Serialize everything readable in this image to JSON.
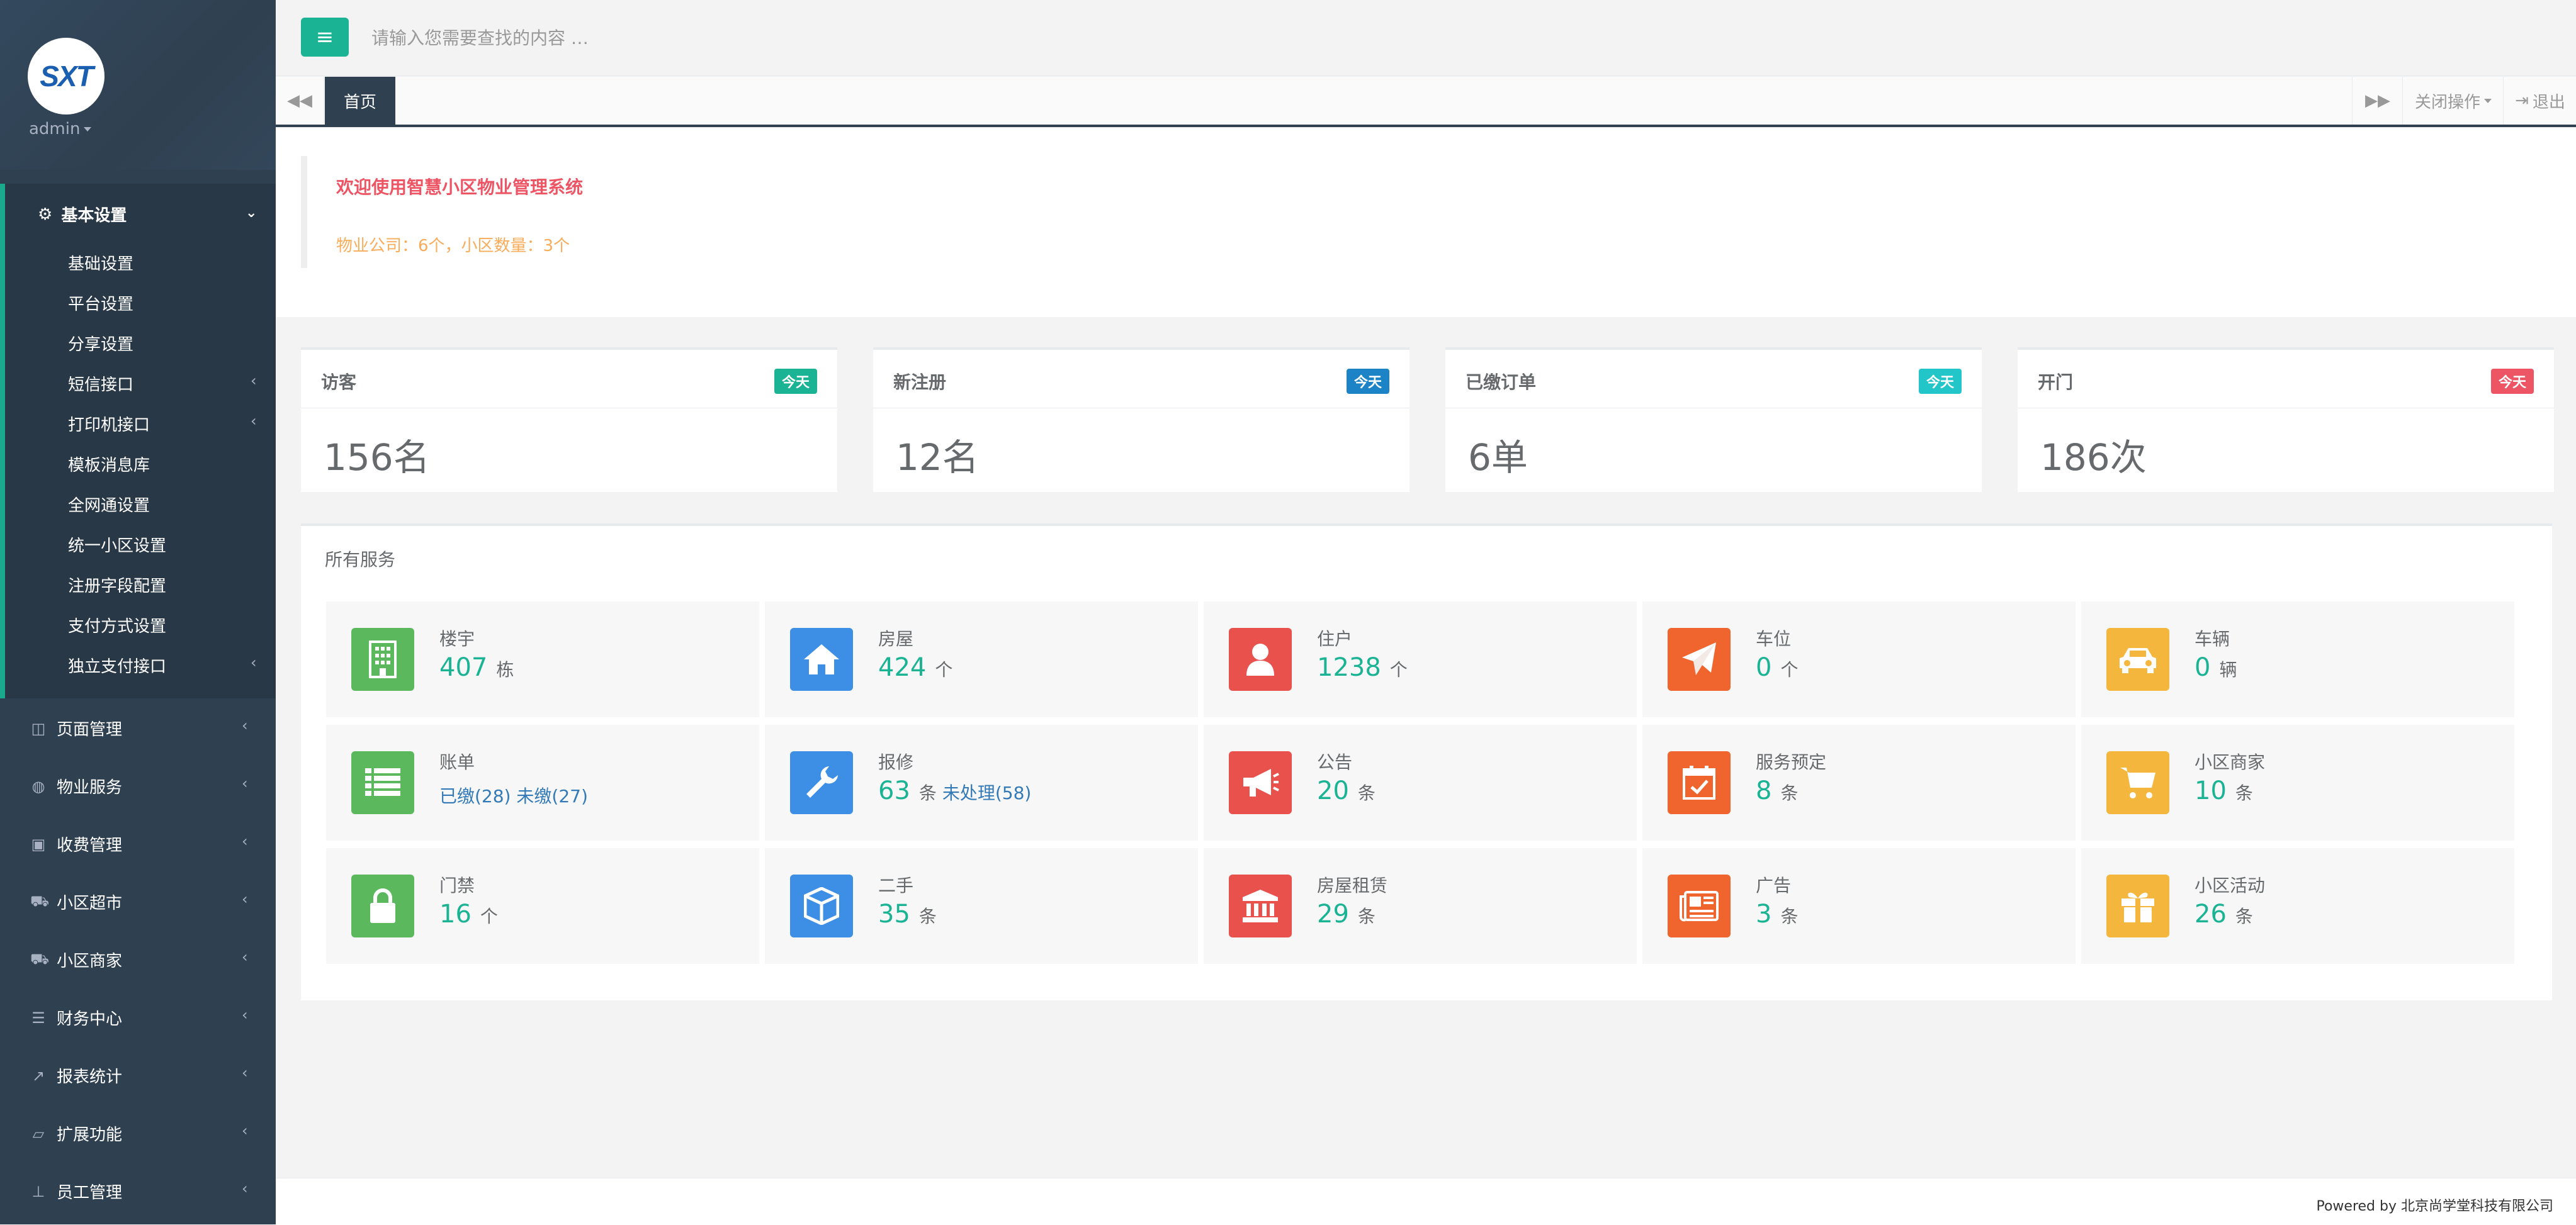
{
  "sidebar": {
    "logo_text": "SXT",
    "username": "admin",
    "active_group": {
      "label": "基本设置",
      "items": [
        {
          "label": "基础设置"
        },
        {
          "label": "平台设置"
        },
        {
          "label": "分享设置"
        },
        {
          "label": "短信接口"
        },
        {
          "label": "打印机接口"
        },
        {
          "label": "模板消息库"
        },
        {
          "label": "全网通设置"
        },
        {
          "label": "统一小区设置"
        },
        {
          "label": "注册字段配置"
        },
        {
          "label": "支付方式设置"
        },
        {
          "label": "独立支付接口"
        }
      ]
    },
    "groups": [
      {
        "label": "页面管理",
        "icon": "columns-icon"
      },
      {
        "label": "物业服务",
        "icon": "globe-icon"
      },
      {
        "label": "收费管理",
        "icon": "money-icon"
      },
      {
        "label": "小区超市",
        "icon": "cart-icon"
      },
      {
        "label": "小区商家",
        "icon": "truck-icon"
      },
      {
        "label": "财务中心",
        "icon": "database-icon"
      },
      {
        "label": "报表统计",
        "icon": "line-chart-icon"
      },
      {
        "label": "扩展功能",
        "icon": "folder-open-icon"
      },
      {
        "label": "员工管理",
        "icon": "sitemap-icon"
      }
    ]
  },
  "topbar": {
    "search_placeholder": "请输入您需要查找的内容 …"
  },
  "tabs": {
    "home": "首页",
    "close_ops": "关闭操作",
    "logout": "退出"
  },
  "welcome": {
    "title": "欢迎使用智慧小区物业管理系统",
    "stats": "物业公司：6个，小区数量：3个"
  },
  "cards": [
    {
      "title": "访客",
      "badge": "今天",
      "badge_color": "#1ab394",
      "value": "156名"
    },
    {
      "title": "新注册",
      "badge": "今天",
      "badge_color": "#1c84c6",
      "value": "12名"
    },
    {
      "title": "已缴订单",
      "badge": "今天",
      "badge_color": "#23c6c8",
      "value": "6单"
    },
    {
      "title": "开门",
      "badge": "今天",
      "badge_color": "#ed5565",
      "value": "186次"
    }
  ],
  "services": {
    "title": "所有服务",
    "items": [
      {
        "name": "楼宇",
        "num": "407",
        "unit": "栋",
        "icon": "building-icon",
        "color": "#5cb85c"
      },
      {
        "name": "房屋",
        "num": "424",
        "unit": "个",
        "icon": "home-icon",
        "color": "#3d8fe6"
      },
      {
        "name": "住户",
        "num": "1238",
        "unit": "个",
        "icon": "user-icon",
        "color": "#e8514c"
      },
      {
        "name": "车位",
        "num": "0",
        "unit": "个",
        "icon": "paper-plane-icon",
        "color": "#f0652d"
      },
      {
        "name": "车辆",
        "num": "0",
        "unit": "辆",
        "icon": "car-icon",
        "color": "#f4b63c"
      },
      {
        "name": "账单",
        "paid": "已缴(28)",
        "unpaid": "未缴(27)",
        "icon": "list-icon",
        "color": "#5cb85c"
      },
      {
        "name": "报修",
        "num": "63",
        "unit": "条",
        "extra": "未处理(58)",
        "icon": "wrench-icon",
        "color": "#3d8fe6"
      },
      {
        "name": "公告",
        "num": "20",
        "unit": "条",
        "icon": "bullhorn-icon",
        "color": "#e8514c"
      },
      {
        "name": "服务预定",
        "num": "8",
        "unit": "条",
        "icon": "calendar-check-icon",
        "color": "#f0652d"
      },
      {
        "name": "小区商家",
        "num": "10",
        "unit": "条",
        "icon": "shopping-cart-icon",
        "color": "#f4b63c"
      },
      {
        "name": "门禁",
        "num": "16",
        "unit": "个",
        "icon": "lock-icon",
        "color": "#5cb85c"
      },
      {
        "name": "二手",
        "num": "35",
        "unit": "条",
        "icon": "cube-icon",
        "color": "#3d8fe6"
      },
      {
        "name": "房屋租赁",
        "num": "29",
        "unit": "条",
        "icon": "bank-icon",
        "color": "#e8514c"
      },
      {
        "name": "广告",
        "num": "3",
        "unit": "条",
        "icon": "newspaper-icon",
        "color": "#f0652d"
      },
      {
        "name": "小区活动",
        "num": "26",
        "unit": "条",
        "icon": "gift-icon",
        "color": "#f4b63c"
      }
    ]
  },
  "footer": {
    "text": "Powered by 北京尚学堂科技有限公司"
  }
}
